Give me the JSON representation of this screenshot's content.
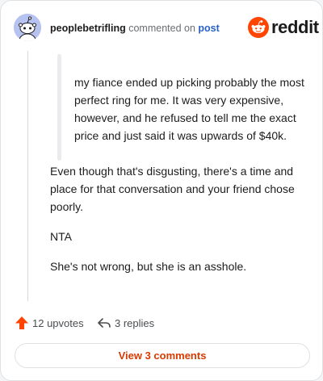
{
  "header": {
    "username": "peoplebetrifling",
    "verb": "commented on",
    "target": "post",
    "logo_text": "reddit",
    "avatar_icon": "snoo-avatar-icon",
    "logo_icon": "reddit-alien-icon"
  },
  "comment": {
    "quote": "my fiance ended up picking probably the most perfect ring for me. It was very expensive, however, and he refused to tell me the exact price and just said it was upwards of $40k.",
    "paragraphs": [
      "Even though that's disgusting, there's a time and place for that conversation and your friend chose poorly.",
      "NTA",
      "She's not wrong, but she is an asshole."
    ]
  },
  "actions": {
    "upvotes_label": "12 upvotes",
    "replies_label": "3 replies",
    "upvote_icon": "upvote-arrow-icon",
    "reply_icon": "reply-arrow-icon"
  },
  "footer": {
    "view_comments_label": "View 3 comments"
  },
  "colors": {
    "accent": "#d93a00",
    "link": "#2a61c7",
    "upvote": "#ff4500",
    "reddit_orange": "#ff4500"
  }
}
